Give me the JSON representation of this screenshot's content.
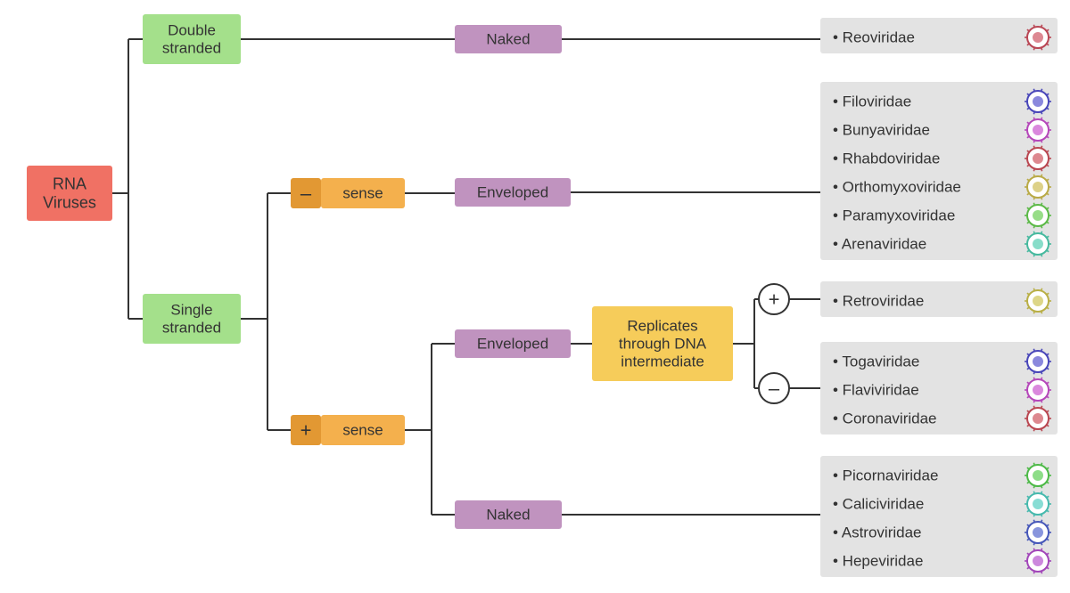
{
  "root": {
    "label": "RNA\nViruses"
  },
  "strand": {
    "double": "Double\nstranded",
    "single": "Single\nstranded"
  },
  "sense": {
    "minus": "sense",
    "plus": "sense",
    "minus_sign": "–",
    "plus_sign": "+"
  },
  "envelope": {
    "naked1": "Naked",
    "env1": "Enveloped",
    "env2": "Enveloped",
    "naked2": "Naked"
  },
  "dna_intermediate": "Replicates\nthrough DNA\nintermediate",
  "symbols": {
    "plus_circle": "+",
    "minus_circle": "–"
  },
  "families": {
    "reo": [
      "Reoviridae"
    ],
    "neg_env": [
      "Filoviridae",
      "Bunyaviridae",
      "Rhabdoviridae",
      "Orthomyxoviridae",
      "Paramyxoviridae",
      "Arenaviridae"
    ],
    "retro": [
      "Retroviridae"
    ],
    "pos_env_nodna": [
      "Togaviridae",
      "Flaviviridae",
      "Coronaviridae"
    ],
    "pos_naked": [
      "Picornaviridae",
      "Caliciviridae",
      "Astroviridae",
      "Hepeviridae"
    ]
  },
  "colors": {
    "root": "#f07164",
    "green": "#a4e08b",
    "orange": "#f4b04d",
    "orange_dark": "#e29833",
    "purple": "#c093bf",
    "yellow": "#f6cc5a",
    "grey": "#e3e3e3",
    "line": "#333333",
    "text": "#333333"
  },
  "chart_data": {
    "type": "tree",
    "title": "Classification of RNA Viruses",
    "root": "RNA Viruses",
    "nodes": [
      {
        "id": "root",
        "label": "RNA Viruses",
        "children": [
          "ds",
          "ss"
        ]
      },
      {
        "id": "ds",
        "label": "Double stranded",
        "children": [
          "ds_naked"
        ]
      },
      {
        "id": "ds_naked",
        "label": "Naked",
        "families": [
          "Reoviridae"
        ]
      },
      {
        "id": "ss",
        "label": "Single stranded",
        "children": [
          "ss_minus",
          "ss_plus"
        ]
      },
      {
        "id": "ss_minus",
        "label": "– sense",
        "children": [
          "ss_minus_env"
        ]
      },
      {
        "id": "ss_minus_env",
        "label": "Enveloped",
        "families": [
          "Filoviridae",
          "Bunyaviridae",
          "Rhabdoviridae",
          "Orthomyxoviridae",
          "Paramyxoviridae",
          "Arenaviridae"
        ]
      },
      {
        "id": "ss_plus",
        "label": "+ sense",
        "children": [
          "ss_plus_env",
          "ss_plus_naked"
        ]
      },
      {
        "id": "ss_plus_env",
        "label": "Enveloped",
        "children": [
          "dna_int"
        ]
      },
      {
        "id": "dna_int",
        "label": "Replicates through DNA intermediate",
        "children": [
          "dna_yes",
          "dna_no"
        ]
      },
      {
        "id": "dna_yes",
        "label": "+",
        "families": [
          "Retroviridae"
        ]
      },
      {
        "id": "dna_no",
        "label": "–",
        "families": [
          "Togaviridae",
          "Flaviviridae",
          "Coronaviridae"
        ]
      },
      {
        "id": "ss_plus_naked",
        "label": "Naked",
        "families": [
          "Picornaviridae",
          "Caliciviridae",
          "Astroviridae",
          "Hepeviridae"
        ]
      }
    ]
  }
}
